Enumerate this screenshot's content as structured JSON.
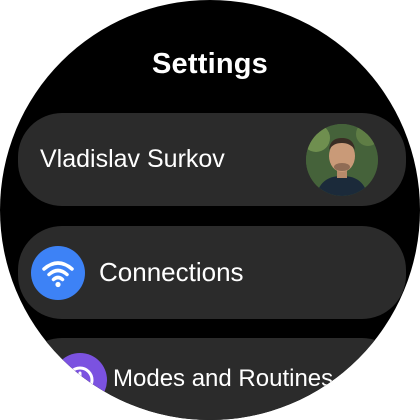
{
  "header": {
    "title": "Settings"
  },
  "profile": {
    "name": "Vladislav Surkov"
  },
  "menu": {
    "items": [
      {
        "label": "Connections",
        "icon": "wifi-icon",
        "icon_color": "#3d82f6"
      },
      {
        "label": "Modes and Routines",
        "icon": "modes-icon",
        "icon_color": "#7b52e0"
      }
    ]
  },
  "colors": {
    "background": "#000000",
    "card": "#2b2b2b",
    "text": "#ffffff"
  }
}
